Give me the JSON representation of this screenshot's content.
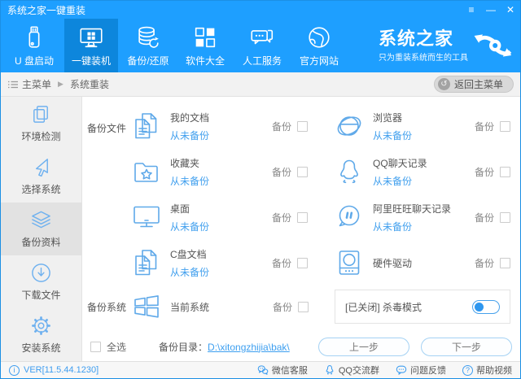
{
  "window": {
    "title": "系统之家一键重装",
    "controls": {
      "menu": "≡",
      "minimize": "—",
      "close": "✕"
    }
  },
  "nav": {
    "items": [
      {
        "label": "U 盘启动",
        "icon": "usb-icon",
        "active": false
      },
      {
        "label": "一键装机",
        "icon": "monitor-install-icon",
        "active": true
      },
      {
        "label": "备份/还原",
        "icon": "database-restore-icon",
        "active": false
      },
      {
        "label": "软件大全",
        "icon": "apps-icon",
        "active": false
      },
      {
        "label": "人工服务",
        "icon": "chat-service-icon",
        "active": false
      },
      {
        "label": "官方网站",
        "icon": "globe-icon",
        "active": false
      }
    ],
    "brand": {
      "name": "系统之家",
      "slogan": "只为重装系统而生的工具"
    }
  },
  "breadcrumb": {
    "root": "主菜单",
    "separator": "▶",
    "current": "系统重装",
    "back_button": "返回主菜单",
    "back_icon_glyph": "↺"
  },
  "sidebar": {
    "items": [
      {
        "label": "环境检测",
        "icon": "env-check-icon",
        "active": false
      },
      {
        "label": "选择系统",
        "icon": "cursor-icon",
        "active": false
      },
      {
        "label": "备份资料",
        "icon": "layers-icon",
        "active": true
      },
      {
        "label": "下载文件",
        "icon": "download-icon",
        "active": false
      },
      {
        "label": "安装系统",
        "icon": "gear-icon",
        "active": false
      }
    ]
  },
  "main": {
    "files_section_label": "备份文件",
    "backup_label": "备份",
    "file_items": [
      {
        "name": "我的文档",
        "status": "从未备份",
        "icon": "documents-icon",
        "checked": false
      },
      {
        "name": "浏览器",
        "status": "从未备份",
        "icon": "browser-icon",
        "checked": false
      },
      {
        "name": "收藏夹",
        "status": "从未备份",
        "icon": "favorites-folder-icon",
        "checked": false
      },
      {
        "name": "QQ聊天记录",
        "status": "从未备份",
        "icon": "qq-icon",
        "checked": false
      },
      {
        "name": "桌面",
        "status": "从未备份",
        "icon": "desktop-icon",
        "checked": false
      },
      {
        "name": "阿里旺旺聊天记录",
        "status": "从未备份",
        "icon": "wangwang-icon",
        "checked": false
      },
      {
        "name": "C盘文档",
        "status": "从未备份",
        "icon": "c-drive-docs-icon",
        "checked": false
      },
      {
        "name": "硬件驱动",
        "status": "",
        "icon": "hardware-driver-icon",
        "checked": false
      }
    ],
    "system_section_label": "备份系统",
    "system_item": {
      "name": "当前系统",
      "icon": "windows-icon",
      "checked": false
    },
    "antivirus": {
      "label": "[已关闭] 杀毒模式",
      "state": "off"
    },
    "select_all_label": "全选",
    "backup_dir_label": "备份目录：",
    "backup_dir_path": "D:\\xitongzhijia\\bak\\",
    "prev_button": "上一步",
    "next_button": "下一步"
  },
  "footer": {
    "version": "VER[11.5.44.1230]",
    "version_icon_glyph": "i",
    "links": [
      {
        "label": "微信客服",
        "icon": "wechat-icon",
        "glyph": ""
      },
      {
        "label": "QQ交流群",
        "icon": "qq-icon",
        "glyph": ""
      },
      {
        "label": "问题反馈",
        "icon": "feedback-icon",
        "glyph": ""
      },
      {
        "label": "帮助视频",
        "icon": "help-icon",
        "glyph": "?"
      }
    ]
  }
}
